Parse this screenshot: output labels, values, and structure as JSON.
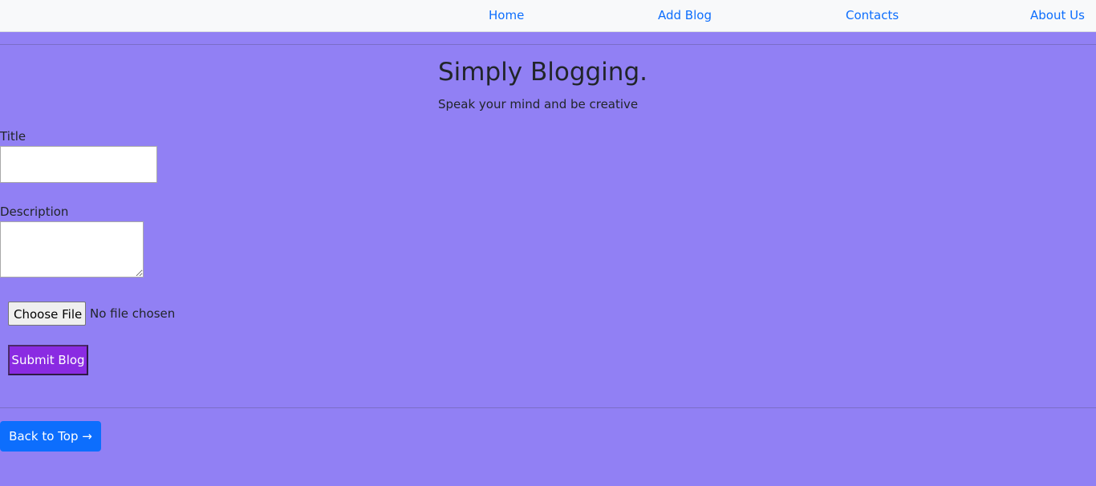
{
  "navbar": {
    "links": [
      {
        "label": "Home"
      },
      {
        "label": "Add Blog"
      },
      {
        "label": "Contacts"
      },
      {
        "label": "About Us"
      }
    ]
  },
  "header": {
    "title": "Simply Blogging.",
    "subtitle": "Speak your mind and be creative"
  },
  "form": {
    "title_label": "Title",
    "title_value": "",
    "description_label": "Description",
    "description_value": "",
    "file_button_label": "Choose File",
    "file_status": "No file chosen",
    "submit_label": "Submit Blog"
  },
  "footer": {
    "back_to_top_label": "Back to Top →"
  },
  "colors": {
    "page_background": "#9180f4",
    "navbar_background": "#f8f9fa",
    "nav_link": "#0d6efd",
    "submit_button": "#8a2be2",
    "back_to_top_button": "#0d6efd"
  }
}
